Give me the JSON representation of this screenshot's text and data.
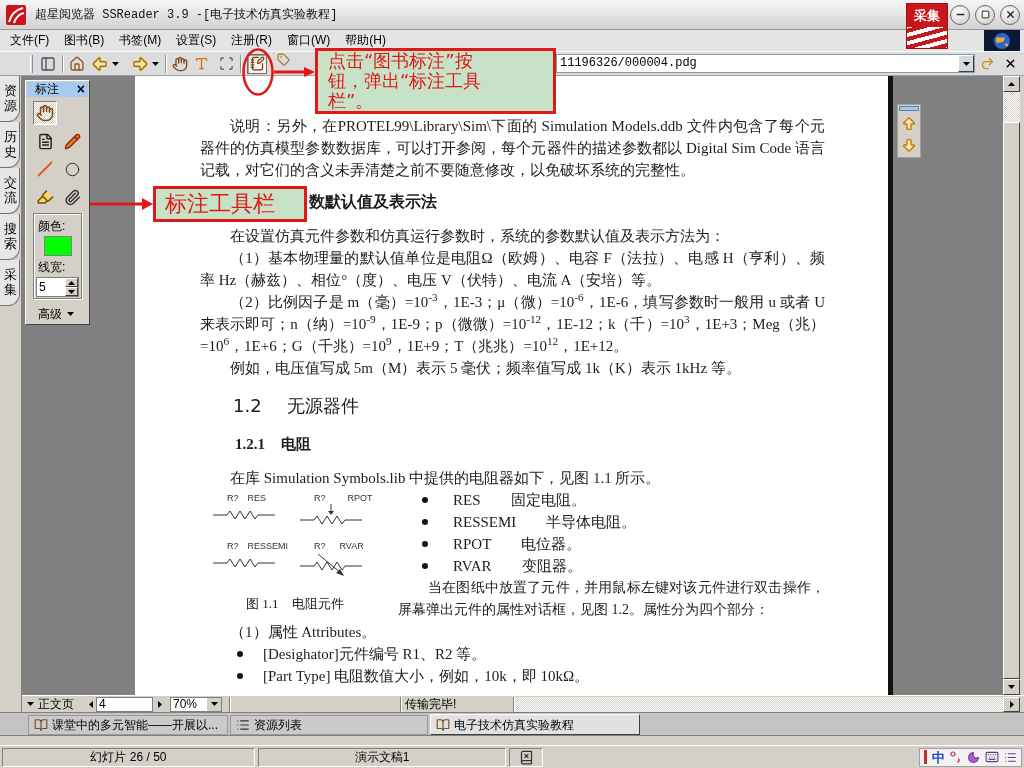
{
  "window": {
    "title": "超星阅览器 SSReader 3.9 -[电子技术仿真实验教程]",
    "badge": "采集"
  },
  "menu": [
    "文件(F)",
    "图书(B)",
    "书签(M)",
    "设置(S)",
    "注册(R)",
    "窗口(W)",
    "帮助(H)"
  ],
  "address_bar": {
    "value": "11196326/000004.pdg"
  },
  "side_tabs": [
    {
      "label": "资源"
    },
    {
      "label": "历史"
    },
    {
      "label": "交流"
    },
    {
      "label": "搜索"
    },
    {
      "label": "采集"
    }
  ],
  "annotation_panel": {
    "title": "标注",
    "close": "×",
    "tools": [
      {
        "kind": "hand",
        "selected": true
      },
      {
        "kind": "note",
        "selected": false
      },
      {
        "kind": "pencil",
        "selected": false
      },
      {
        "kind": "line",
        "selected": false
      },
      {
        "kind": "circle",
        "selected": false
      },
      {
        "kind": "highlighter",
        "selected": false
      },
      {
        "kind": "clip",
        "selected": false
      }
    ],
    "color_label": "颜色:",
    "color": "#00ff00",
    "width_label": "线宽:",
    "width_value": "5",
    "advanced": "高级"
  },
  "document": {
    "blocks": [
      {
        "kind": "paragraph",
        "text": "说明：另外，在PROTEL99\\Library\\Sim\\下面的 Simulation Models.ddb 文件内包含了每个元器件的仿真模型参数数据库，可以打开参阅，每个元器件的描述参数都以 Digital Sim Code 语言记载，对它们的含义未弄清楚之前不要随意修改，以免破坏系统的完整性。"
      },
      {
        "kind": "heading",
        "text": "数默认值及表示法"
      },
      {
        "kind": "paragraph",
        "text": "在设置仿真元件参数和仿真运行参数时，系统的参数默认值及表示方法为："
      },
      {
        "kind": "paragraph",
        "text": "（1）基本物理量的默认值单位是电阻Ω（欧姆）、电容 F（法拉）、电感 H（亨利）、频率 Hz（赫兹）、相位°（度）、电压 V（伏特）、电流 A（安培）等。"
      },
      {
        "kind": "paragraph",
        "text": "（2）比例因子是 m（毫）=10$^{-3}$，1E-3；μ（微）=10$^{-6}$，1E-6，填写参数时一般用 u 或者 U 来表示即可；n（纳）=10$^{-9}$，1E-9；p（微微）=10$^{-12}$，1E-12；k（千）=10$^{3}$，1E+3；Meg（兆）=10$^{6}$，1E+6；G（千兆）=10$^{9}$，1E+9；T（兆兆）=10$^{12}$，1E+12。"
      },
      {
        "kind": "paragraph",
        "text": "例如，电压值写成 5m（M）表示 5 毫伏；频率值写成 1k（K）表示 1kHz 等。"
      },
      {
        "kind": "section",
        "number": "1.2",
        "title": "无源器件"
      },
      {
        "kind": "subsection",
        "number": "1.2.1",
        "title": "电阻"
      },
      {
        "kind": "paragraph",
        "text": "在库 Simulation Symbols.lib 中提供的电阻器如下，见图 1.1 所示。"
      },
      {
        "kind": "figure",
        "symbols": [
          {
            "kind": "fixed",
            "ref": "R?",
            "type": "RES"
          },
          {
            "kind": "pot",
            "ref": "R?",
            "type": "RPOT"
          },
          {
            "kind": "fixed",
            "ref": "R?",
            "type": "RESSEMI"
          },
          {
            "kind": "variable",
            "ref": "R?",
            "type": "RVAR"
          }
        ],
        "caption": "图 1.1　电阻元件",
        "items": [
          {
            "term": "RES",
            "desc": "固定电阻。"
          },
          {
            "term": "RESSEMI",
            "desc": "半导体电阻。"
          },
          {
            "term": "RPOT",
            "desc": "电位器。"
          },
          {
            "term": "RVAR",
            "desc": "变阻器。"
          }
        ],
        "text": "当在图纸中放置了元件，并用鼠标左键对该元件进行双击操作，屏幕弹出元件的属性对话框，见图 1.2。属性分为四个部分："
      },
      {
        "kind": "paragraph",
        "text": "（1）属性 Attributes。"
      },
      {
        "kind": "bullets",
        "items": [
          "[Desighator]元件编号 R1、R2 等。",
          "[Part Type] 电阻数值大小，例如，10k，即 10kΩ。"
        ]
      }
    ]
  },
  "reader_status": {
    "page_type": "正文页",
    "page": "4",
    "zoom": "70%",
    "message": "传输完毕!"
  },
  "tabs": [
    {
      "kind": "book",
      "label": "课堂中的多元智能——开展以...",
      "selected": false
    },
    {
      "kind": "list",
      "label": "资源列表",
      "selected": false
    },
    {
      "kind": "book",
      "label": "电子技术仿真实验教程",
      "selected": true
    }
  ],
  "status_bar": {
    "slide": "幻灯片 26 / 50",
    "document": "演示文稿1",
    "ime": "中"
  },
  "callouts": [
    {
      "lines": [
        "点击“图书标注”按",
        "钮，弹出“标注工具",
        "栏”。"
      ]
    },
    {
      "lines": [
        "标注工具栏"
      ]
    }
  ]
}
